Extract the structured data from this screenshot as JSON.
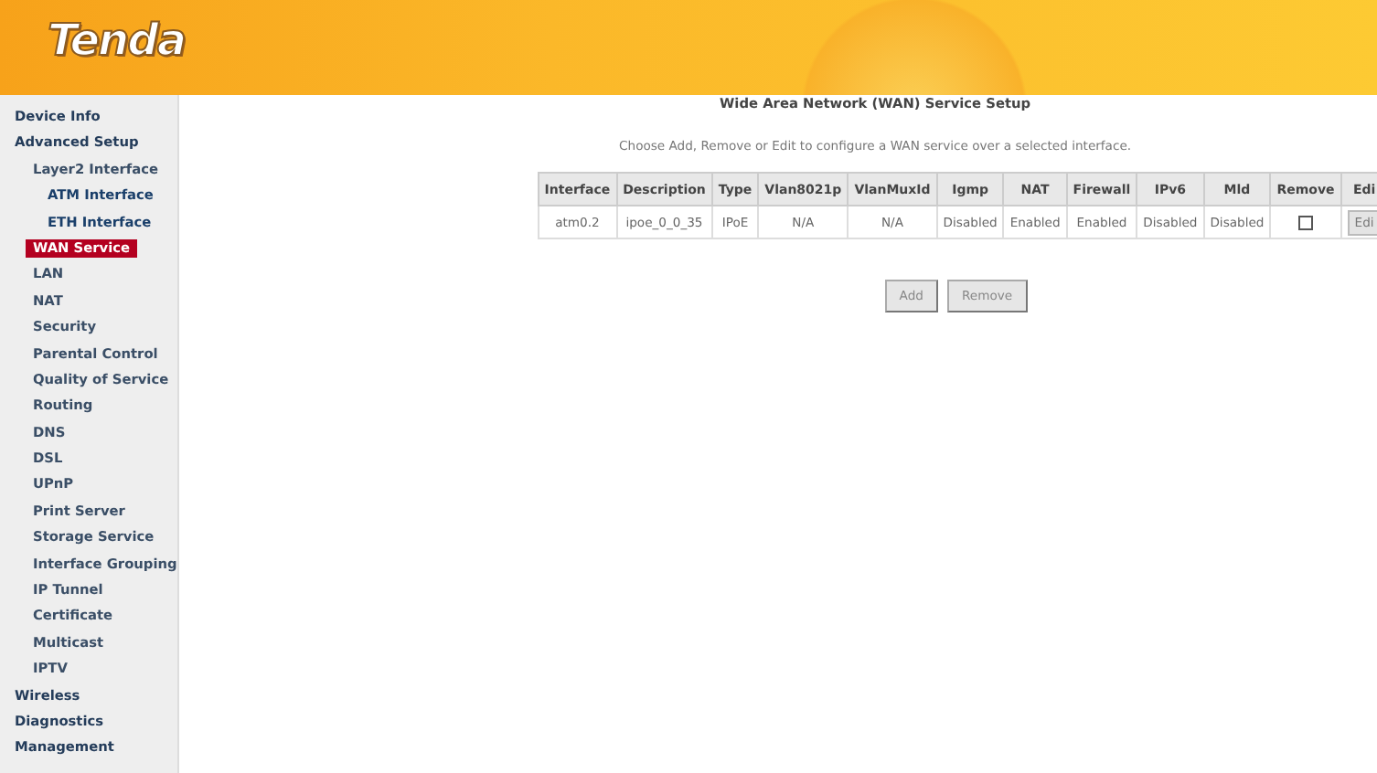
{
  "logo": "Tenda",
  "sidebar": {
    "items": [
      {
        "label": "Device Info",
        "selected": false
      },
      {
        "label": "Advanced Setup",
        "selected": false,
        "children": [
          {
            "label": "Layer2 Interface",
            "selected": false,
            "children": [
              {
                "label": "ATM Interface",
                "selected": false
              },
              {
                "label": "ETH Interface",
                "selected": false
              }
            ]
          },
          {
            "label": "WAN Service",
            "selected": true
          },
          {
            "label": "LAN",
            "selected": false
          },
          {
            "label": "NAT",
            "selected": false
          },
          {
            "label": "Security",
            "selected": false
          },
          {
            "label": "Parental Control",
            "selected": false
          },
          {
            "label": "Quality of Service",
            "selected": false
          },
          {
            "label": "Routing",
            "selected": false
          },
          {
            "label": "DNS",
            "selected": false
          },
          {
            "label": "DSL",
            "selected": false
          },
          {
            "label": "UPnP",
            "selected": false
          },
          {
            "label": "Print Server",
            "selected": false
          },
          {
            "label": "Storage Service",
            "selected": false
          },
          {
            "label": "Interface Grouping",
            "selected": false
          },
          {
            "label": "IP Tunnel",
            "selected": false
          },
          {
            "label": "Certificate",
            "selected": false
          },
          {
            "label": "Multicast",
            "selected": false
          },
          {
            "label": "IPTV",
            "selected": false
          }
        ]
      },
      {
        "label": "Wireless",
        "selected": false
      },
      {
        "label": "Diagnostics",
        "selected": false
      },
      {
        "label": "Management",
        "selected": false
      }
    ]
  },
  "main": {
    "title": "Wide Area Network (WAN) Service Setup",
    "instruction": "Choose Add, Remove or Edit to configure a WAN service over a selected interface.",
    "table": {
      "columns": [
        "Interface",
        "Description",
        "Type",
        "Vlan8021p",
        "VlanMuxId",
        "Igmp",
        "NAT",
        "Firewall",
        "IPv6",
        "Mld",
        "Remove",
        "Edi"
      ],
      "rows": [
        {
          "cells": [
            "atm0.2",
            "ipoe_0_0_35",
            "IPoE",
            "N/A",
            "N/A",
            "Disabled",
            "Enabled",
            "Enabled",
            "Disabled",
            "Disabled"
          ],
          "remove_checked": false,
          "edit_button": "Edi"
        }
      ]
    },
    "buttons": [
      "Add",
      "Remove"
    ]
  }
}
